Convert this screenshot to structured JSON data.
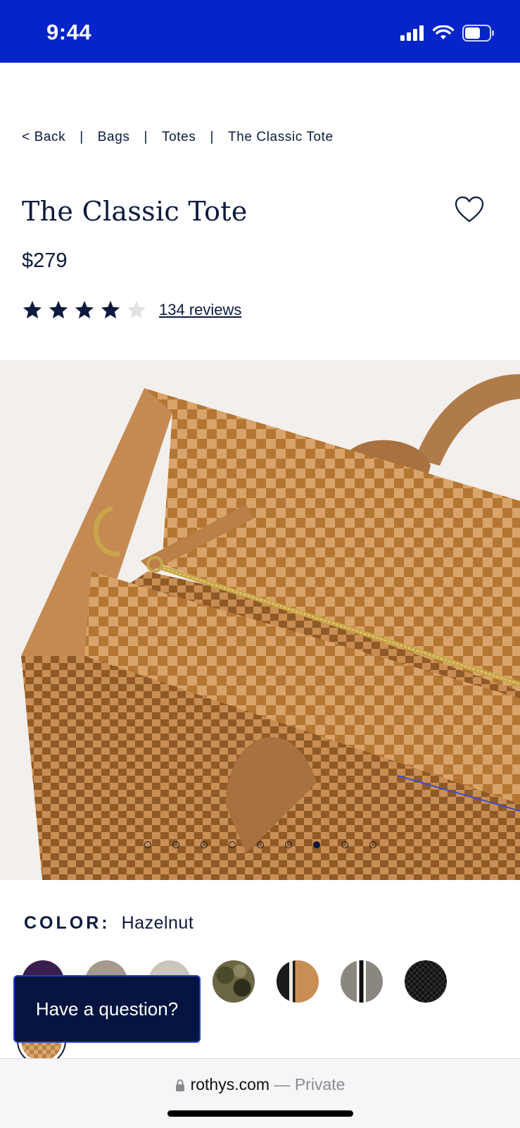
{
  "status_bar": {
    "time": "9:44",
    "battery_level": 0.6,
    "background_color": "#0625c9"
  },
  "breadcrumb": {
    "items": [
      "< Back",
      "Bags",
      "Totes",
      "The Classic Tote"
    ],
    "separator": "|"
  },
  "product": {
    "title": "The Classic Tote",
    "price": "$279",
    "rating": 4,
    "rating_max": 5,
    "reviews_label": "134 reviews"
  },
  "gallery": {
    "image_count": 9,
    "active_index": 6,
    "background_color": "#f2efec"
  },
  "color": {
    "label": "COLOR:",
    "selected": "Hazelnut",
    "swatches": [
      {
        "icon": "swatch-purple"
      },
      {
        "icon": "swatch-taupe"
      },
      {
        "icon": "swatch-light-gray"
      },
      {
        "icon": "swatch-camo"
      },
      {
        "icon": "swatch-black-cream-stripe"
      },
      {
        "icon": "swatch-gray-black-stripe"
      },
      {
        "icon": "swatch-black-weave"
      },
      {
        "icon": "swatch-hazelnut"
      }
    ]
  },
  "chat": {
    "label": "Have a question?"
  },
  "browser": {
    "domain": "rothys.com",
    "suffix": "— Private"
  },
  "colors": {
    "navy": "#0b1a3d",
    "brand_blue": "#0625c9",
    "tan": "#c98e54"
  }
}
